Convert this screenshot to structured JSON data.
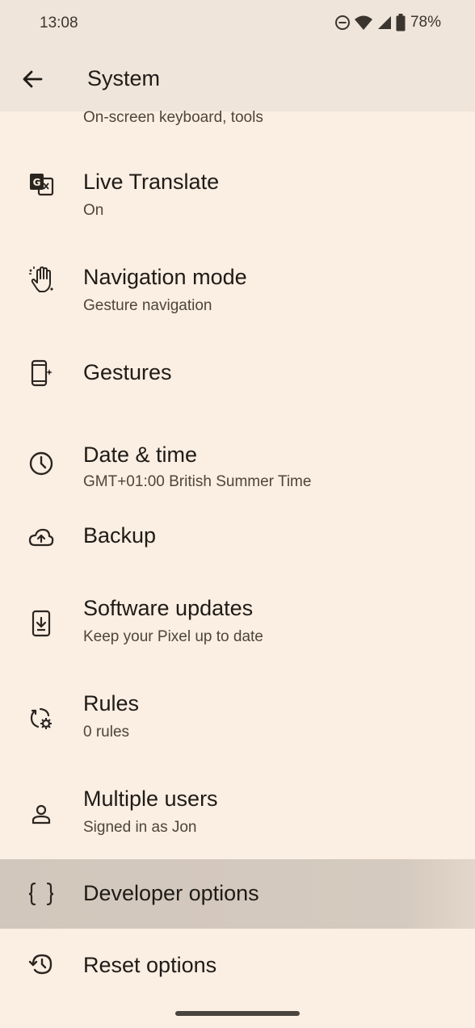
{
  "status_bar": {
    "time": "13:08",
    "battery": "78%",
    "icons": [
      "do-not-disturb-icon",
      "wifi-icon",
      "signal-icon",
      "battery-icon"
    ]
  },
  "app_bar": {
    "title": "System",
    "back_icon": "arrow-back-icon"
  },
  "list": {
    "partial_item_subtitle": "On-screen keyboard, tools",
    "items": [
      {
        "title": "Live Translate",
        "subtitle": "On",
        "icon": "translate-icon"
      },
      {
        "title": "Navigation mode",
        "subtitle": "Gesture navigation",
        "icon": "gesture-hand-icon"
      },
      {
        "title": "Gestures",
        "subtitle": "",
        "icon": "phone-gesture-icon"
      },
      {
        "title": "Date & time",
        "subtitle": "GMT+01:00 British Summer Time",
        "icon": "clock-icon"
      },
      {
        "title": "Backup",
        "subtitle": "",
        "icon": "cloud-upload-icon"
      },
      {
        "title": "Software updates",
        "subtitle": "Keep your Pixel up to date",
        "icon": "system-update-icon"
      },
      {
        "title": "Rules",
        "subtitle": "0 rules",
        "icon": "rules-icon"
      },
      {
        "title": "Multiple users",
        "subtitle": "Signed in as Jon",
        "icon": "person-icon"
      },
      {
        "title": "Developer options",
        "subtitle": "",
        "icon": "code-braces-icon",
        "selected": true
      },
      {
        "title": "Reset options",
        "subtitle": "",
        "icon": "history-icon"
      }
    ]
  },
  "colors": {
    "background": "#FBEEE3",
    "app_bar": "#F0E5DA",
    "selected_row": "#D2C7BC",
    "text_primary": "#1F1B16",
    "text_secondary": "#4F4539"
  }
}
